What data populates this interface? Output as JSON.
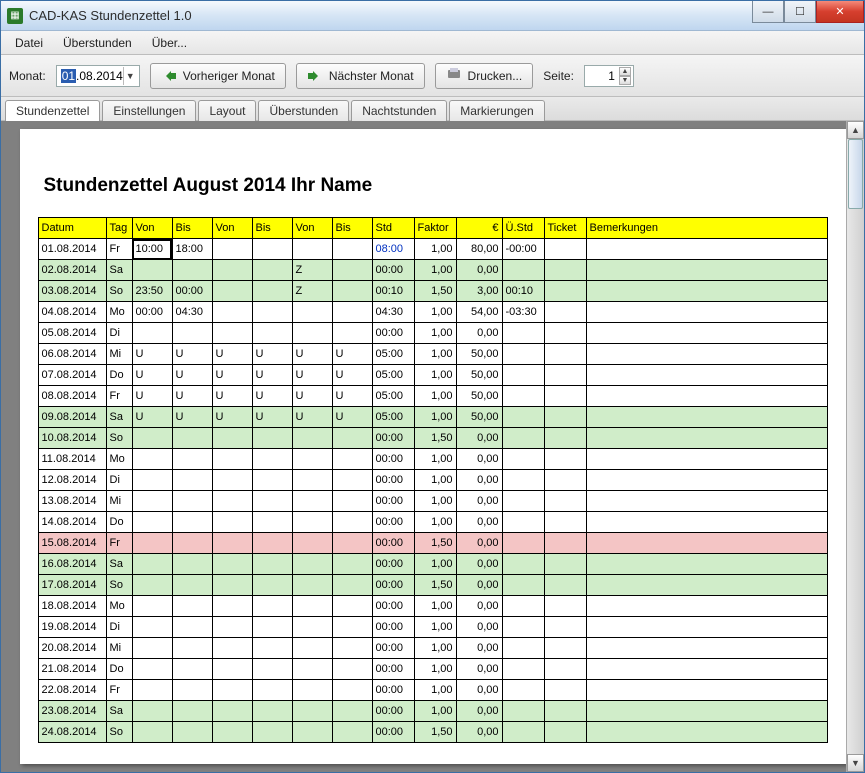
{
  "window": {
    "title": "CAD-KAS Stundenzettel 1.0"
  },
  "menu": {
    "datei": "Datei",
    "uberstunden": "Überstunden",
    "uber": "Über..."
  },
  "toolbar": {
    "monat_label": "Monat:",
    "date_sel": "01",
    "date_rest": ".08.2014",
    "prev": "Vorheriger Monat",
    "next": "Nächster Monat",
    "print": "Drucken...",
    "seite_label": "Seite:",
    "seite_value": "1"
  },
  "tabs": {
    "t0": "Stundenzettel",
    "t1": "Einstellungen",
    "t2": "Layout",
    "t3": "Überstunden",
    "t4": "Nachtstunden",
    "t5": "Markierungen"
  },
  "paper": {
    "title": "Stundenzettel August 2014 Ihr Name"
  },
  "headers": {
    "datum": "Datum",
    "tag": "Tag",
    "von1": "Von",
    "bis1": "Bis",
    "von2": "Von",
    "bis2": "Bis",
    "von3": "Von",
    "bis3": "Bis",
    "std": "Std",
    "faktor": "Faktor",
    "euro": "€",
    "ustd": "Ü.Std",
    "ticket": "Ticket",
    "bem": "Bemerkungen"
  },
  "rows": [
    {
      "date": "01.08.2014",
      "tag": "Fr",
      "v1": "10:00",
      "b1": "18:00",
      "v2": "",
      "b2": "",
      "v3": "",
      "b3": "",
      "std": "08:00",
      "faktor": "1,00",
      "euro": "80,00",
      "ustd": "-00:00",
      "cls": "",
      "blue": true,
      "sel": true
    },
    {
      "date": "02.08.2014",
      "tag": "Sa",
      "v1": "",
      "b1": "",
      "v2": "",
      "b2": "",
      "v3": "Z",
      "b3": "",
      "std": "00:00",
      "faktor": "1,00",
      "euro": "0,00",
      "ustd": "",
      "cls": "green"
    },
    {
      "date": "03.08.2014",
      "tag": "So",
      "v1": "23:50",
      "b1": "00:00",
      "v2": "",
      "b2": "",
      "v3": "Z",
      "b3": "",
      "std": "00:10",
      "faktor": "1,50",
      "euro": "3,00",
      "ustd": "00:10",
      "cls": "green"
    },
    {
      "date": "04.08.2014",
      "tag": "Mo",
      "v1": "00:00",
      "b1": "04:30",
      "v2": "",
      "b2": "",
      "v3": "",
      "b3": "",
      "std": "04:30",
      "faktor": "1,00",
      "euro": "54,00",
      "ustd": "-03:30",
      "cls": ""
    },
    {
      "date": "05.08.2014",
      "tag": "Di",
      "v1": "",
      "b1": "",
      "v2": "",
      "b2": "",
      "v3": "",
      "b3": "",
      "std": "00:00",
      "faktor": "1,00",
      "euro": "0,00",
      "ustd": "",
      "cls": ""
    },
    {
      "date": "06.08.2014",
      "tag": "Mi",
      "v1": "U",
      "b1": "U",
      "v2": "U",
      "b2": "U",
      "v3": "U",
      "b3": "U",
      "std": "05:00",
      "faktor": "1,00",
      "euro": "50,00",
      "ustd": "",
      "cls": ""
    },
    {
      "date": "07.08.2014",
      "tag": "Do",
      "v1": "U",
      "b1": "U",
      "v2": "U",
      "b2": "U",
      "v3": "U",
      "b3": "U",
      "std": "05:00",
      "faktor": "1,00",
      "euro": "50,00",
      "ustd": "",
      "cls": ""
    },
    {
      "date": "08.08.2014",
      "tag": "Fr",
      "v1": "U",
      "b1": "U",
      "v2": "U",
      "b2": "U",
      "v3": "U",
      "b3": "U",
      "std": "05:00",
      "faktor": "1,00",
      "euro": "50,00",
      "ustd": "",
      "cls": ""
    },
    {
      "date": "09.08.2014",
      "tag": "Sa",
      "v1": "U",
      "b1": "U",
      "v2": "U",
      "b2": "U",
      "v3": "U",
      "b3": "U",
      "std": "05:00",
      "faktor": "1,00",
      "euro": "50,00",
      "ustd": "",
      "cls": "green"
    },
    {
      "date": "10.08.2014",
      "tag": "So",
      "v1": "",
      "b1": "",
      "v2": "",
      "b2": "",
      "v3": "",
      "b3": "",
      "std": "00:00",
      "faktor": "1,50",
      "euro": "0,00",
      "ustd": "",
      "cls": "green"
    },
    {
      "date": "11.08.2014",
      "tag": "Mo",
      "v1": "",
      "b1": "",
      "v2": "",
      "b2": "",
      "v3": "",
      "b3": "",
      "std": "00:00",
      "faktor": "1,00",
      "euro": "0,00",
      "ustd": "",
      "cls": ""
    },
    {
      "date": "12.08.2014",
      "tag": "Di",
      "v1": "",
      "b1": "",
      "v2": "",
      "b2": "",
      "v3": "",
      "b3": "",
      "std": "00:00",
      "faktor": "1,00",
      "euro": "0,00",
      "ustd": "",
      "cls": ""
    },
    {
      "date": "13.08.2014",
      "tag": "Mi",
      "v1": "",
      "b1": "",
      "v2": "",
      "b2": "",
      "v3": "",
      "b3": "",
      "std": "00:00",
      "faktor": "1,00",
      "euro": "0,00",
      "ustd": "",
      "cls": ""
    },
    {
      "date": "14.08.2014",
      "tag": "Do",
      "v1": "",
      "b1": "",
      "v2": "",
      "b2": "",
      "v3": "",
      "b3": "",
      "std": "00:00",
      "faktor": "1,00",
      "euro": "0,00",
      "ustd": "",
      "cls": ""
    },
    {
      "date": "15.08.2014",
      "tag": "Fr",
      "v1": "",
      "b1": "",
      "v2": "",
      "b2": "",
      "v3": "",
      "b3": "",
      "std": "00:00",
      "faktor": "1,50",
      "euro": "0,00",
      "ustd": "",
      "cls": "pink"
    },
    {
      "date": "16.08.2014",
      "tag": "Sa",
      "v1": "",
      "b1": "",
      "v2": "",
      "b2": "",
      "v3": "",
      "b3": "",
      "std": "00:00",
      "faktor": "1,00",
      "euro": "0,00",
      "ustd": "",
      "cls": "green"
    },
    {
      "date": "17.08.2014",
      "tag": "So",
      "v1": "",
      "b1": "",
      "v2": "",
      "b2": "",
      "v3": "",
      "b3": "",
      "std": "00:00",
      "faktor": "1,50",
      "euro": "0,00",
      "ustd": "",
      "cls": "green"
    },
    {
      "date": "18.08.2014",
      "tag": "Mo",
      "v1": "",
      "b1": "",
      "v2": "",
      "b2": "",
      "v3": "",
      "b3": "",
      "std": "00:00",
      "faktor": "1,00",
      "euro": "0,00",
      "ustd": "",
      "cls": ""
    },
    {
      "date": "19.08.2014",
      "tag": "Di",
      "v1": "",
      "b1": "",
      "v2": "",
      "b2": "",
      "v3": "",
      "b3": "",
      "std": "00:00",
      "faktor": "1,00",
      "euro": "0,00",
      "ustd": "",
      "cls": ""
    },
    {
      "date": "20.08.2014",
      "tag": "Mi",
      "v1": "",
      "b1": "",
      "v2": "",
      "b2": "",
      "v3": "",
      "b3": "",
      "std": "00:00",
      "faktor": "1,00",
      "euro": "0,00",
      "ustd": "",
      "cls": ""
    },
    {
      "date": "21.08.2014",
      "tag": "Do",
      "v1": "",
      "b1": "",
      "v2": "",
      "b2": "",
      "v3": "",
      "b3": "",
      "std": "00:00",
      "faktor": "1,00",
      "euro": "0,00",
      "ustd": "",
      "cls": ""
    },
    {
      "date": "22.08.2014",
      "tag": "Fr",
      "v1": "",
      "b1": "",
      "v2": "",
      "b2": "",
      "v3": "",
      "b3": "",
      "std": "00:00",
      "faktor": "1,00",
      "euro": "0,00",
      "ustd": "",
      "cls": ""
    },
    {
      "date": "23.08.2014",
      "tag": "Sa",
      "v1": "",
      "b1": "",
      "v2": "",
      "b2": "",
      "v3": "",
      "b3": "",
      "std": "00:00",
      "faktor": "1,00",
      "euro": "0,00",
      "ustd": "",
      "cls": "green"
    },
    {
      "date": "24.08.2014",
      "tag": "So",
      "v1": "",
      "b1": "",
      "v2": "",
      "b2": "",
      "v3": "",
      "b3": "",
      "std": "00:00",
      "faktor": "1,50",
      "euro": "0,00",
      "ustd": "",
      "cls": "green"
    }
  ]
}
